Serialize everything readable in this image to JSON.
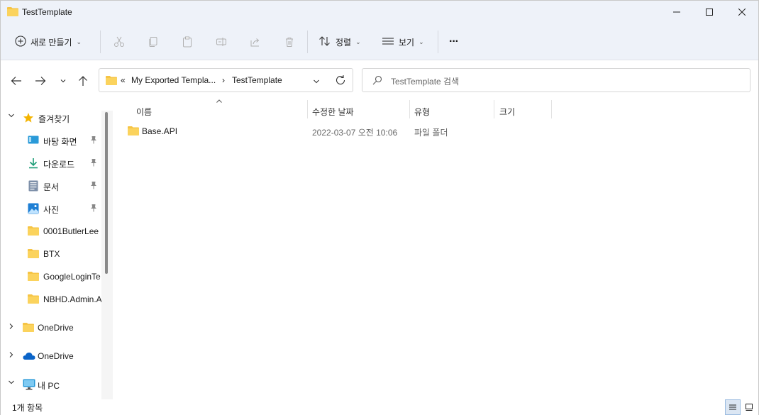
{
  "window": {
    "title": "TestTemplate"
  },
  "toolbar": {
    "new_label": "새로 만들기",
    "sort_label": "정렬",
    "view_label": "보기",
    "more_label": "···"
  },
  "address": {
    "overflow": "«",
    "crumbs": [
      "My Exported Templa...",
      "TestTemplate"
    ],
    "separator": "›"
  },
  "search": {
    "placeholder": "TestTemplate 검색"
  },
  "nav": {
    "favorites": "즐겨찾기",
    "desktop": "바탕 화면",
    "downloads": "다운로드",
    "documents": "문서",
    "pictures": "사진",
    "folder1": "0001ButlerLee",
    "folder2": "BTX",
    "folder3": "GoogleLoginTe",
    "folder4": "NBHD.Admin.A",
    "onedrive1": "OneDrive",
    "onedrive2": "OneDrive",
    "thispc": "내 PC"
  },
  "columns": {
    "name": "이름",
    "modified": "수정한 날짜",
    "type": "유형",
    "size": "크기"
  },
  "files": [
    {
      "name": "Base.API",
      "modified": "2022-03-07 오전 10:06",
      "type": "파일 폴더",
      "size": ""
    }
  ],
  "status": {
    "count": "1개 항목"
  },
  "colors": {
    "chrome_bg": "#eef2f9",
    "folder": "#f6c445",
    "accent": "#0067c0"
  }
}
